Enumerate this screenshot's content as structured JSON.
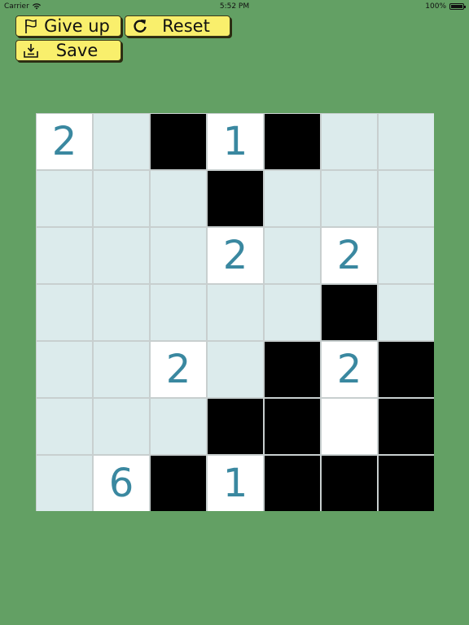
{
  "status_bar": {
    "carrier": "Carrier",
    "time": "5:52 PM",
    "battery": "100%",
    "battery_level": 1.0
  },
  "toolbar": {
    "give_up_label": "Give up",
    "give_up_icon": "flag-icon",
    "reset_label": "Reset",
    "reset_icon": "refresh-icon",
    "save_label": "Save",
    "save_icon": "save-icon",
    "button_color": "#f9ef6c"
  },
  "colors": {
    "background": "#63a064",
    "empty_cell": "#dcebec",
    "white_cell": "#ffffff",
    "black_cell": "#000000",
    "clue_text": "#3a88a0"
  },
  "board": {
    "rows": [
      [
        {
          "state": "clue",
          "value": "2"
        },
        {
          "state": "empty"
        },
        {
          "state": "black"
        },
        {
          "state": "clue",
          "value": "1"
        },
        {
          "state": "black"
        },
        {
          "state": "empty"
        },
        {
          "state": "empty"
        }
      ],
      [
        {
          "state": "empty"
        },
        {
          "state": "empty"
        },
        {
          "state": "empty"
        },
        {
          "state": "black"
        },
        {
          "state": "empty"
        },
        {
          "state": "empty"
        },
        {
          "state": "empty"
        }
      ],
      [
        {
          "state": "empty"
        },
        {
          "state": "empty"
        },
        {
          "state": "empty"
        },
        {
          "state": "clue",
          "value": "2"
        },
        {
          "state": "empty"
        },
        {
          "state": "clue",
          "value": "2"
        },
        {
          "state": "empty"
        }
      ],
      [
        {
          "state": "empty"
        },
        {
          "state": "empty"
        },
        {
          "state": "empty"
        },
        {
          "state": "empty"
        },
        {
          "state": "empty"
        },
        {
          "state": "black"
        },
        {
          "state": "empty"
        }
      ],
      [
        {
          "state": "empty"
        },
        {
          "state": "empty"
        },
        {
          "state": "clue",
          "value": "2"
        },
        {
          "state": "empty"
        },
        {
          "state": "black"
        },
        {
          "state": "clue",
          "value": "2"
        },
        {
          "state": "black"
        }
      ],
      [
        {
          "state": "empty"
        },
        {
          "state": "empty"
        },
        {
          "state": "empty"
        },
        {
          "state": "black"
        },
        {
          "state": "black"
        },
        {
          "state": "white"
        },
        {
          "state": "black"
        }
      ],
      [
        {
          "state": "empty"
        },
        {
          "state": "clue",
          "value": "6"
        },
        {
          "state": "black"
        },
        {
          "state": "clue",
          "value": "1"
        },
        {
          "state": "black"
        },
        {
          "state": "black"
        },
        {
          "state": "black"
        }
      ]
    ]
  }
}
